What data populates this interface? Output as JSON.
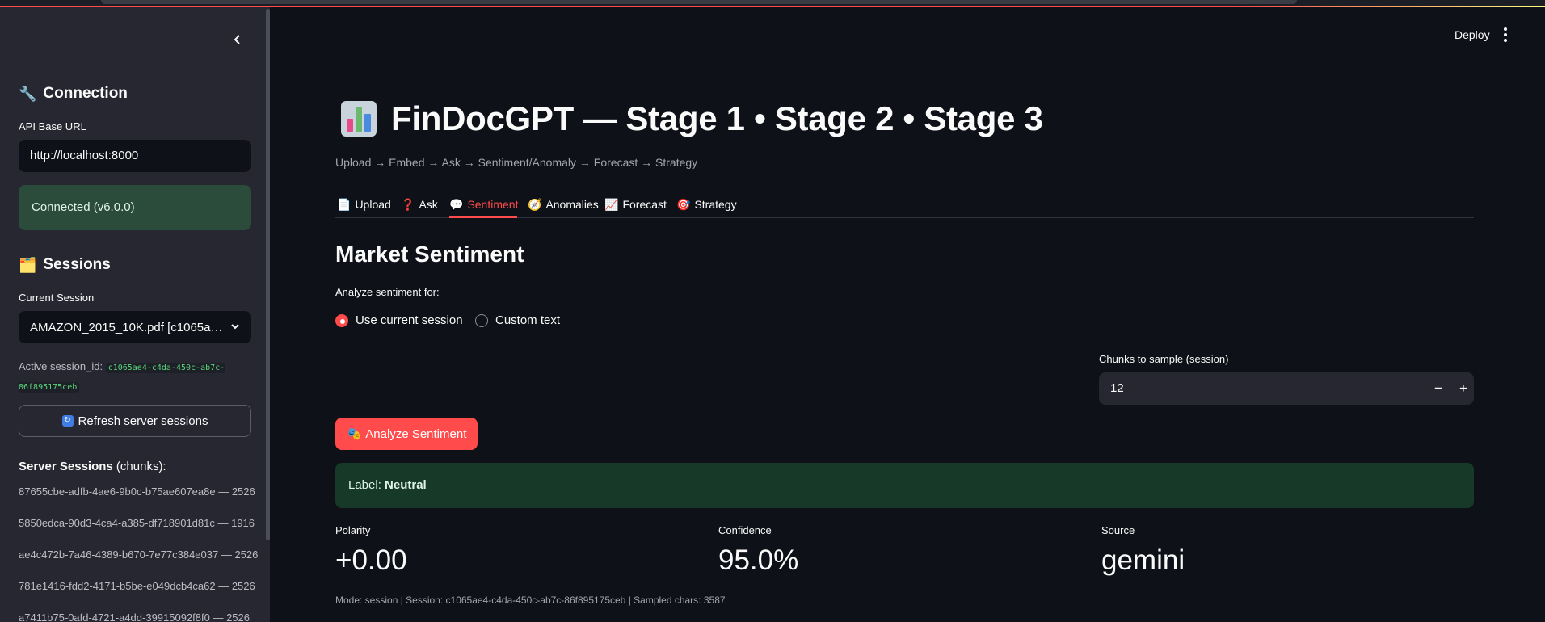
{
  "sidebar": {
    "connection_title": "Connection",
    "api_label": "API Base URL",
    "api_value": "http://localhost:8000",
    "connected_text": "Connected (v6.0.0)",
    "sessions_title": "Sessions",
    "current_session_label": "Current Session",
    "current_session_value": "AMAZON_2015_10K.pdf [c1065a…",
    "active_session_label": "Active session_id:",
    "active_session_id": "c1065ae4-c4da-450c-ab7c-86f895175ceb",
    "refresh_label": "Refresh server sessions",
    "server_sessions_bold": "Server Sessions",
    "server_sessions_suffix": " (chunks):",
    "server_sessions": [
      "87655cbe-adfb-4ae6-9b0c-b75ae607ea8e — 2526",
      "5850edca-90d3-4ca4-a385-df718901d81c — 1916",
      "ae4c472b-7a46-4389-b670-7e77c384e037 — 2526",
      "781e1416-fdd2-4171-b5be-e049dcb4ca62 — 2526",
      "a7411b75-0afd-4721-a4dd-39915092f8f0 — 2526"
    ]
  },
  "header": {
    "deploy_label": "Deploy"
  },
  "main": {
    "title": "FinDocGPT — Stage 1 • Stage 2 • Stage 3",
    "subtitle": "Upload → Embed → Ask → Sentiment/Anomaly → Forecast → Strategy",
    "tabs": [
      {
        "icon": "📄",
        "label": "Upload"
      },
      {
        "icon": "❓",
        "label": "Ask"
      },
      {
        "icon": "💬",
        "label": "Sentiment"
      },
      {
        "icon": "🧭",
        "label": "Anomalies"
      },
      {
        "icon": "📈",
        "label": "Forecast"
      },
      {
        "icon": "🎯",
        "label": "Strategy"
      }
    ],
    "active_tab": "Sentiment",
    "section_title": "Market Sentiment",
    "analyze_for_label": "Analyze sentiment for:",
    "radio_options": [
      "Use current session",
      "Custom text"
    ],
    "radio_selected": "Use current session",
    "chunks_label": "Chunks to sample (session)",
    "chunks_value": "12",
    "analyze_button": "Analyze Sentiment",
    "result_prefix": "Label: ",
    "result_label": "Neutral",
    "metrics": [
      {
        "label": "Polarity",
        "value": "+0.00"
      },
      {
        "label": "Confidence",
        "value": "95.0%"
      },
      {
        "label": "Source",
        "value": "gemini"
      }
    ],
    "caption": "Mode: session | Session: c1065ae4-c4da-450c-ab7c-86f895175ceb | Sampled chars: 3587"
  },
  "colors": {
    "accent": "#ff4b4b",
    "background": "#0e1117",
    "sidebar": "#262730",
    "success_bg": "#2b4c3a",
    "result_bg": "#173928"
  }
}
